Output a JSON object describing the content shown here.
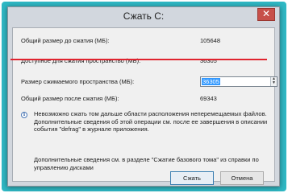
{
  "window": {
    "title": "Сжать С:",
    "close_glyph": "✕"
  },
  "fields": {
    "total_before": {
      "label": "Общий размер до сжатия (МБ):",
      "value": "105648"
    },
    "available": {
      "label": "Доступное для сжатия пространство (МБ):",
      "value": "36305"
    },
    "shrink_size": {
      "label": "Размер сжимаемого пространства (МБ):",
      "value": "36305"
    },
    "total_after": {
      "label": "Общий размер после сжатия (МБ):",
      "value": "69343"
    }
  },
  "info": {
    "icon": "info-icon",
    "text": "Невозможно сжать том дальше области расположения неперемещаемых файлов. Дополнительные сведения об этой операции см. после ее завершения в описании события \"defrag\" в журнале приложения.",
    "more": "Дополнительные сведения см. в разделе \"Сжатие базового тома\" из справки по управлению дисками"
  },
  "buttons": {
    "shrink": "Сжать",
    "cancel": "Отмена"
  },
  "colors": {
    "frame": "#2fb8c4",
    "highlight_line": "#e0242f",
    "selection": "#3399ff"
  }
}
